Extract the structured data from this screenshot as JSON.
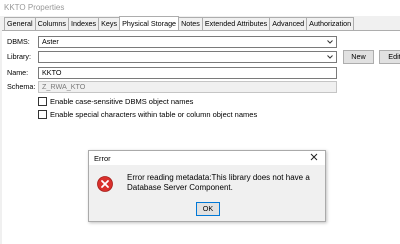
{
  "window": {
    "title": "KKTO Properties"
  },
  "tabs": [
    {
      "label": "General"
    },
    {
      "label": "Columns"
    },
    {
      "label": "Indexes"
    },
    {
      "label": "Keys"
    },
    {
      "label": "Physical Storage",
      "active": true
    },
    {
      "label": "Notes"
    },
    {
      "label": "Extended Attributes"
    },
    {
      "label": "Advanced"
    },
    {
      "label": "Authorization"
    }
  ],
  "form": {
    "dbms_label": "DBMS:",
    "dbms_value": "Aster",
    "library_label": "Library:",
    "library_value": "",
    "new_button": "New",
    "edit_button": "Edit",
    "name_label": "Name:",
    "name_value": "KKTO",
    "schema_label": "Schema:",
    "schema_value": "Z_RWA_KTO",
    "checkbox_case_sensitive": "Enable case-sensitive DBMS object names",
    "checkbox_special_chars": "Enable special characters within table or column object names"
  },
  "dialog": {
    "title": "Error",
    "message": "Error reading metadata:This library does not have a Database Server Component.",
    "ok_button": "OK",
    "icon": "error-icon"
  }
}
